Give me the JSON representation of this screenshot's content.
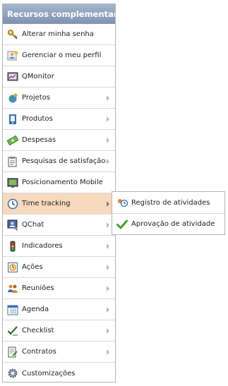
{
  "menu": {
    "title": "Recursos complementares",
    "items": [
      {
        "label": "Alterar minha senha",
        "icon": "key-icon",
        "submenu": false
      },
      {
        "label": "Gerenciar o meu perfil",
        "icon": "user-profile-icon",
        "submenu": false
      },
      {
        "label": "QMonitor",
        "icon": "monitor-chart-icon",
        "submenu": false
      },
      {
        "label": "Projetos",
        "icon": "projects-icon",
        "submenu": true
      },
      {
        "label": "Produtos",
        "icon": "products-icon",
        "submenu": true
      },
      {
        "label": "Despesas",
        "icon": "money-icon",
        "submenu": true
      },
      {
        "label": "Pesquisas de satisfação",
        "icon": "survey-icon",
        "submenu": true
      },
      {
        "label": "Posicionamento Mobile",
        "icon": "mobile-screen-icon",
        "submenu": false
      },
      {
        "label": "Time tracking",
        "icon": "clock-icon",
        "submenu": true,
        "active": true
      },
      {
        "label": "QChat",
        "icon": "chat-icon",
        "submenu": true
      },
      {
        "label": "Indicadores",
        "icon": "traffic-light-icon",
        "submenu": true
      },
      {
        "label": "Ações",
        "icon": "actions-icon",
        "submenu": true
      },
      {
        "label": "Reuniões",
        "icon": "meeting-icon",
        "submenu": true
      },
      {
        "label": "Agenda",
        "icon": "calendar-icon",
        "submenu": true
      },
      {
        "label": "Checklist",
        "icon": "checklist-icon",
        "submenu": true
      },
      {
        "label": "Contratos",
        "icon": "contract-icon",
        "submenu": true
      },
      {
        "label": "Customizações",
        "icon": "gear-icon",
        "submenu": false
      }
    ]
  },
  "submenu": {
    "items": [
      {
        "label": "Registro de atividades",
        "icon": "activity-log-icon"
      },
      {
        "label": "Aprovação de atividade",
        "icon": "check-icon"
      }
    ]
  },
  "colors": {
    "header": "#8d9eb8",
    "active_row": "#f8d9bd",
    "check": "#3aa52a"
  }
}
